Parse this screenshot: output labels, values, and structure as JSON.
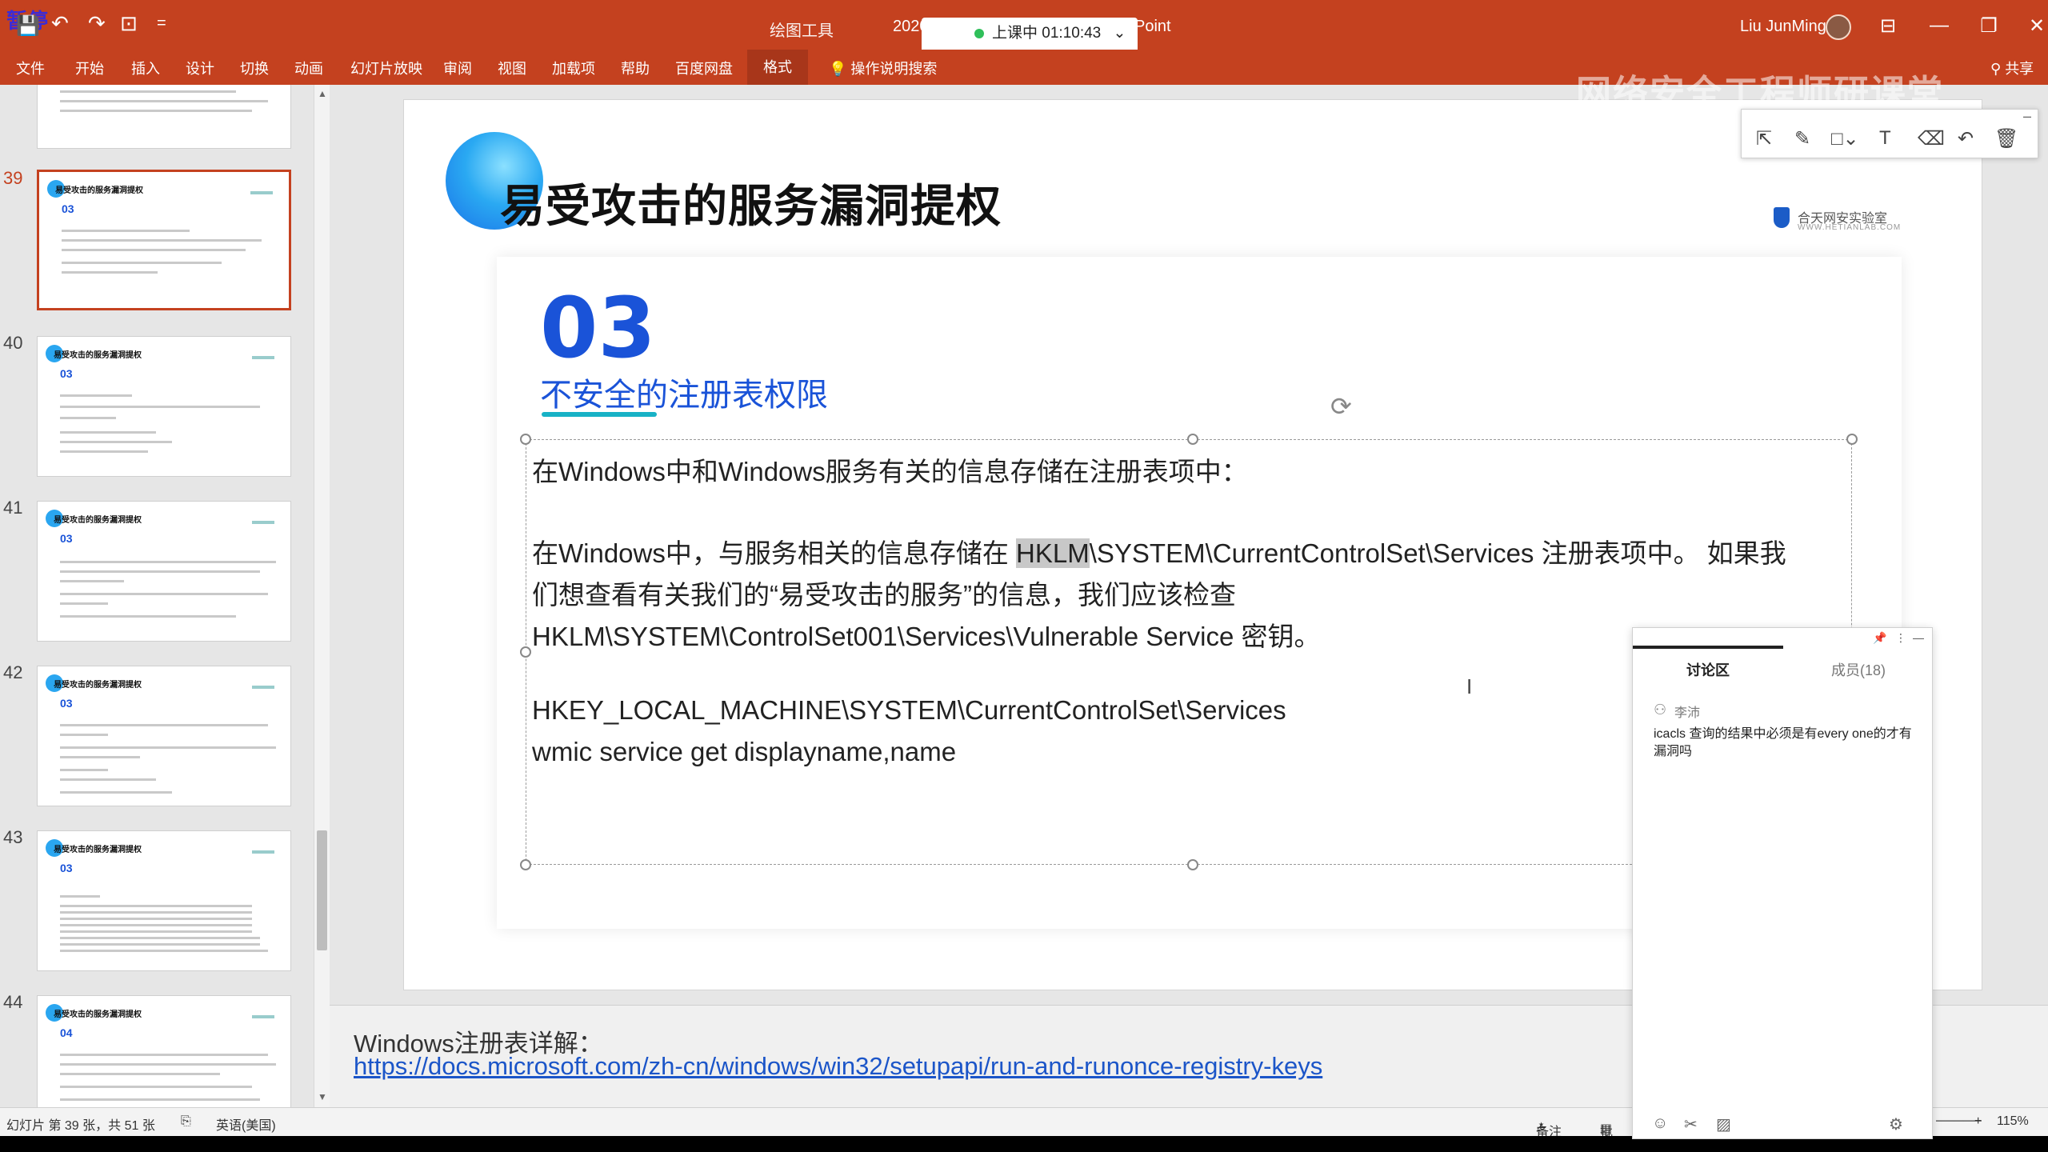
{
  "window": {
    "paused_label": "暂停",
    "context_tools": "绘图工具",
    "title_year": "2020",
    "title_suffix": "Point",
    "user_name": "Liu JunMing",
    "live_status": "上课中 01:10:43"
  },
  "quick_access": {
    "save": "💾",
    "undo": "↶",
    "redo": "↷",
    "present": "⊡",
    "more": "="
  },
  "window_buttons": {
    "ribbon_display": "⊟",
    "minimize": "—",
    "restore": "❐",
    "close": "✕"
  },
  "ribbon": {
    "tabs": [
      "文件",
      "开始",
      "插入",
      "设计",
      "切换",
      "动画",
      "幻灯片放映",
      "审阅",
      "视图",
      "加载项",
      "帮助",
      "百度网盘",
      "格式"
    ],
    "active_tab": "格式",
    "search_label": "操作说明搜索",
    "share_label": "共享"
  },
  "thumbnails": [
    {
      "num": "",
      "title": "",
      "section": ""
    },
    {
      "num": "39",
      "title": "易受攻击的服务漏洞提权",
      "section": "03",
      "selected": true
    },
    {
      "num": "40",
      "title": "易受攻击的服务漏洞提权",
      "section": "03"
    },
    {
      "num": "41",
      "title": "易受攻击的服务漏洞提权",
      "section": "03"
    },
    {
      "num": "42",
      "title": "易受攻击的服务漏洞提权",
      "section": "03"
    },
    {
      "num": "43",
      "title": "易受攻击的服务漏洞提权",
      "section": "03"
    },
    {
      "num": "44",
      "title": "易受攻击的服务漏洞提权",
      "section": "04"
    }
  ],
  "slide": {
    "title": "易受攻击的服务漏洞提权",
    "logo": "合天网安实验室",
    "logo_sub": "WWW.HETIANLAB.COM",
    "section_number": "03",
    "section_title": "不安全的注册表权限",
    "para1": "在Windows中和Windows服务有关的信息存储在注册表项中：",
    "para2_prefix": "在Windows中，与服务相关的信息存储在 ",
    "para2_highlight": "HKLM",
    "para2_suffix": "\\SYSTEM\\CurrentControlSet\\Services 注册表项中。 如果我",
    "para3": "们想查看有关我们的“易受攻击的服务”的信息，我们应该检查",
    "para4": "HKLM\\SYSTEM\\ControlSet001\\Services\\Vulnerable Service 密钥。",
    "para5": "HKEY_LOCAL_MACHINE\\SYSTEM\\CurrentControlSet\\Services",
    "para6": "wmic service get displayname,name"
  },
  "notes": {
    "label": "Windows注册表详解：",
    "link": "https://docs.microsoft.com/zh-cn/windows/win32/setupapi/run-and-runonce-registry-keys"
  },
  "status": {
    "slide_info": "幻灯片 第 39 张，共 51 张",
    "language": "英语(美国)",
    "notes": "备注",
    "comments": "批",
    "zoom": "115%"
  },
  "watermark": "网络安全工程师研课堂",
  "discussion": {
    "tab_discuss": "讨论区",
    "tab_members": "成员(18)",
    "author": "李沛",
    "message": "icacls 查询的结果中必须是有every one的才有漏洞吗"
  }
}
